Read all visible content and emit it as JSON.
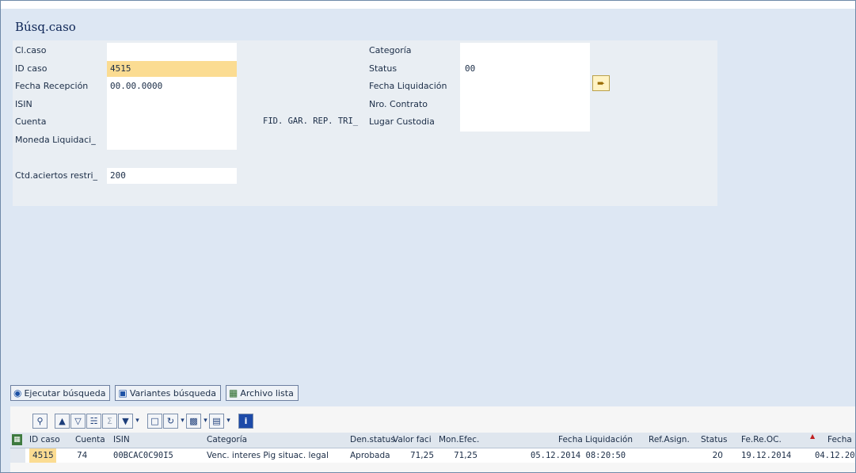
{
  "window": {
    "title": "Búsq.caso"
  },
  "form": {
    "cl_caso": {
      "label": "Cl.caso",
      "value": ""
    },
    "id_caso": {
      "label": "ID caso",
      "value": "4515"
    },
    "fecha_recepcion": {
      "label": "Fecha Recepción",
      "value": "00.00.0000"
    },
    "isin": {
      "label": "ISIN",
      "value": ""
    },
    "cuenta": {
      "label": "Cuenta",
      "value": ""
    },
    "moneda_liquidacion": {
      "label": "Moneda Liquidaci_",
      "value": ""
    },
    "ctd_aciertos": {
      "label": "Ctd.aciertos restri_",
      "value": "200"
    },
    "fid_text": "FID. GAR. REP. TRI_",
    "categoria": {
      "label": "Categoría",
      "value": ""
    },
    "status": {
      "label": "Status",
      "value": "00"
    },
    "fecha_liquidacion": {
      "label": "Fecha Liquidación",
      "value": ""
    },
    "nro_contrato": {
      "label": "Nro. Contrato",
      "value": ""
    },
    "lugar_custodia": {
      "label": "Lugar Custodia",
      "value": ""
    },
    "exec_icon": "arrow-right-icon"
  },
  "actions": {
    "ejecutar": "Ejecutar búsqueda",
    "variantes": "Variantes búsqueda",
    "archivo": "Archivo lista"
  },
  "alv_toolbar": {
    "icons": [
      "details-icon",
      "print-icon",
      "filter-icon",
      "find-icon",
      "sum-icon",
      "subtotal-icon",
      "print-preview-icon",
      "refresh-icon",
      "export-icon",
      "layout-icon",
      "info-icon"
    ],
    "info_label": "i"
  },
  "table": {
    "columns": [
      "ID caso",
      "Cuenta",
      "ISIN",
      "Categoría",
      "Den.status",
      "Valor faci",
      "Mon.Efec.",
      "Fecha Liquidación",
      "Ref.Asign.",
      "Status",
      "Fe.Re.OC.",
      "Fecha"
    ],
    "rows": [
      [
        "4515",
        "74",
        "00BCAC0C90I5",
        "Venc. interes Pig situac. legal",
        "Aprobada",
        "71,25",
        "71,25",
        "05.12.2014 08:20:50",
        "",
        "20",
        "19.12.2014",
        "04.12.20"
      ]
    ]
  },
  "colors": {
    "background": "#dde7f3",
    "form_panel": "#e9eef3",
    "highlight": "#fbdc92",
    "title": "#0c2455"
  }
}
